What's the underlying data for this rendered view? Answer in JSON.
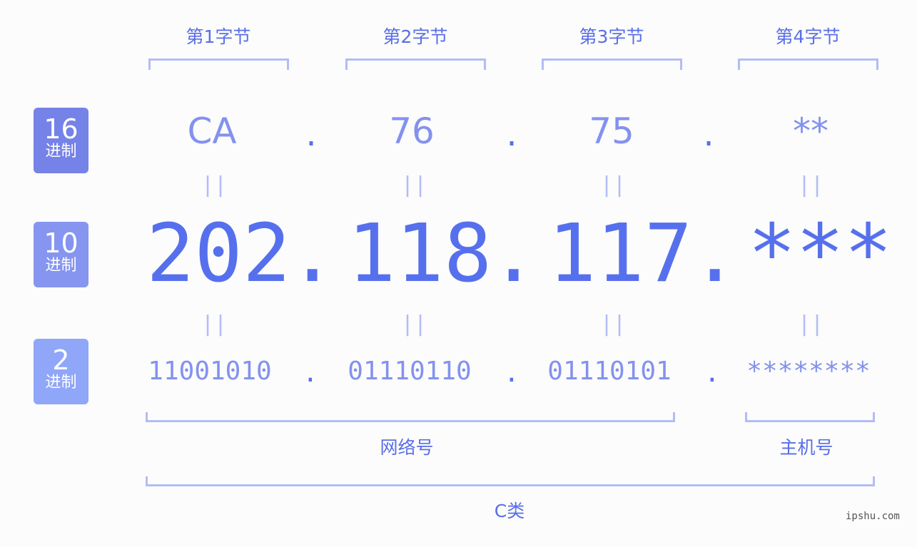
{
  "bytes": [
    {
      "label": "第1字节",
      "hex": "CA",
      "dec": "202",
      "bin": "11001010"
    },
    {
      "label": "第2字节",
      "hex": "76",
      "dec": "118",
      "bin": "01110110"
    },
    {
      "label": "第3字节",
      "hex": "75",
      "dec": "117",
      "bin": "01110101"
    },
    {
      "label": "第4字节",
      "hex": "**",
      "dec": "***",
      "bin": "********"
    }
  ],
  "separator": ".",
  "equals": "||",
  "badges": [
    {
      "num": "16",
      "unit": "进制",
      "color": "#7582e8"
    },
    {
      "num": "10",
      "unit": "进制",
      "color": "#8595f0"
    },
    {
      "num": "2",
      "unit": "进制",
      "color": "#90a6f8"
    }
  ],
  "network_label": "网络号",
  "host_label": "主机号",
  "class_label": "C类",
  "watermark": "ipshu.com",
  "colors": {
    "primary": "#5670ed",
    "secondary": "#8391ef",
    "bracket": "#b3bcf6"
  }
}
